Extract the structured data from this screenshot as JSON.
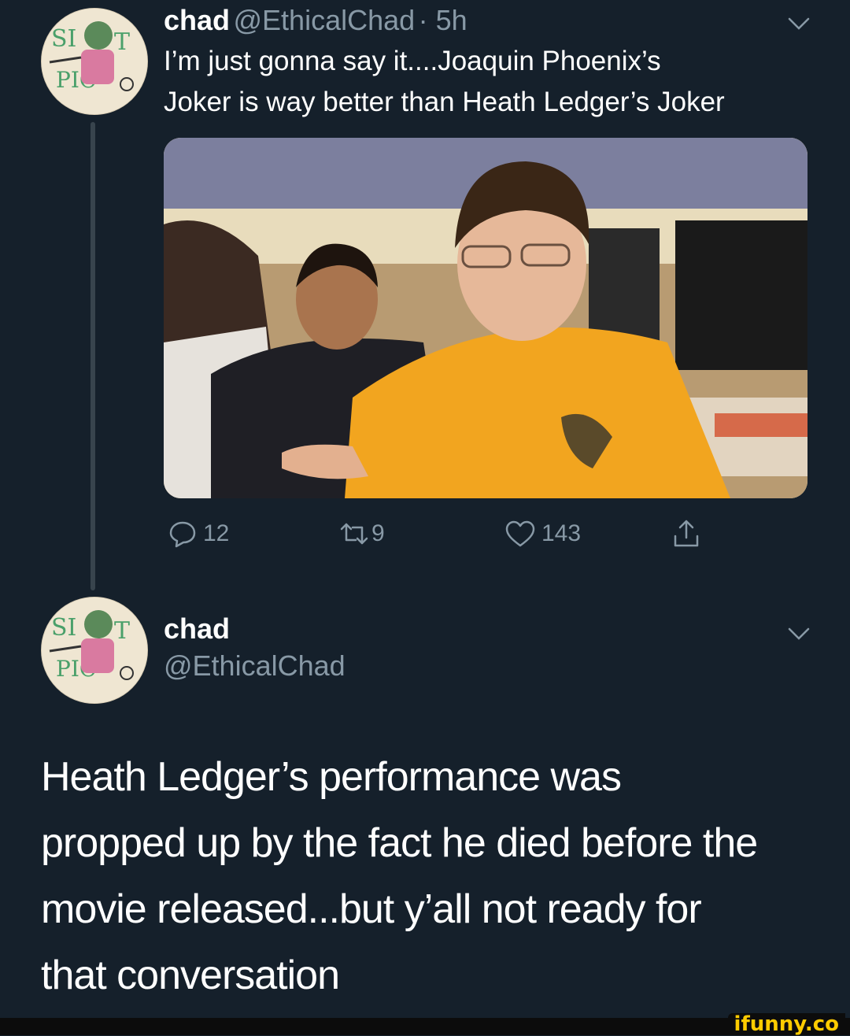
{
  "tweet1": {
    "name": "chad",
    "handle": "@EthicalChad",
    "time": "· 5h",
    "text_line1": "I’m just gonna say it....Joaquin Phoenix’s",
    "text_line2": "Joker is way better than Heath Ledger’s Joker",
    "reply_count": "12",
    "retweet_count": "9",
    "like_count": "143"
  },
  "tweet2": {
    "name": "chad",
    "handle": "@EthicalChad",
    "text_lines": [
      "Heath Ledger’s performance was",
      "propped up by the fact he died before the",
      "movie released...but y’all not ready for",
      "that conversation"
    ]
  },
  "watermark": "ifunny.co",
  "colors": {
    "background": "#15202b",
    "secondary_text": "#8899a6",
    "thread_line": "#38444d",
    "watermark": "#ffcc00"
  },
  "icons": [
    "reply-icon",
    "retweet-icon",
    "like-icon",
    "share-icon",
    "chevron-down-icon"
  ]
}
